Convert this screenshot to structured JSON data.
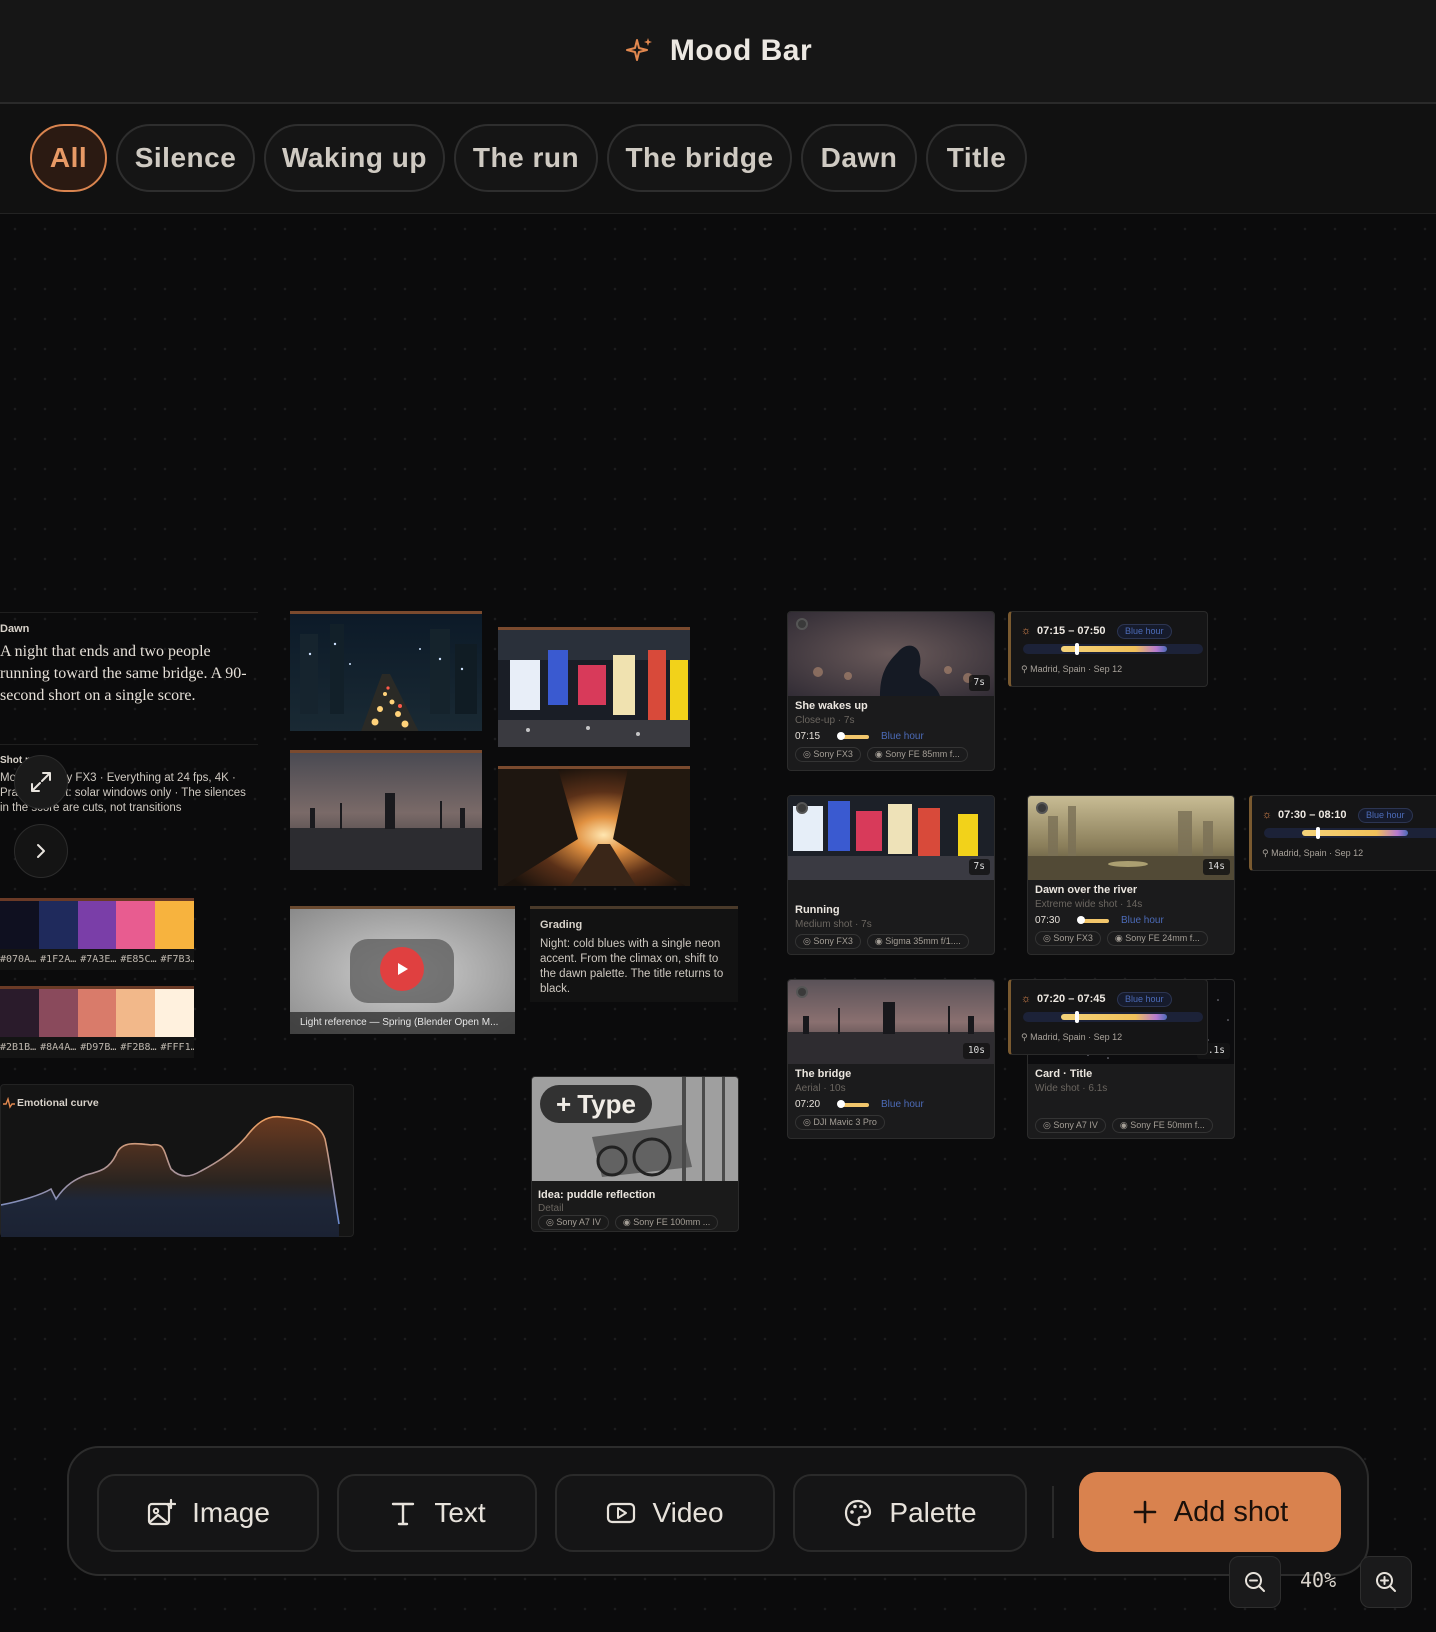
{
  "app": {
    "title": "Mood Bar",
    "icon": "sparkle-icon"
  },
  "tabs": [
    {
      "label": "All",
      "active": true
    },
    {
      "label": "Silence"
    },
    {
      "label": "Waking up"
    },
    {
      "label": "The run"
    },
    {
      "label": "The bridge"
    },
    {
      "label": "Dawn"
    },
    {
      "label": "Title"
    }
  ],
  "dawn_note": {
    "label": "Dawn",
    "text": "A night that ends and two people running toward the same bridge. A 90-second short on a single score."
  },
  "shot_notes": {
    "label": "Shot notes",
    "text": "Mostly a Sony FX3 · Everything at 24 fps, 4K · Practical light: solar windows only · The silences in the score are cuts, not transitions"
  },
  "palettes": [
    {
      "colors": [
        "#0F1020",
        "#1F2A5C",
        "#7A3EA8",
        "#E85C90",
        "#F7B33E"
      ],
      "codes": [
        "#070A…",
        "#1F2A…",
        "#7A3E…",
        "#E85C…",
        "#F7B3…"
      ]
    },
    {
      "colors": [
        "#2A1B2B",
        "#8A4A5C",
        "#D97B6A",
        "#F2B88A",
        "#FFF1DE"
      ],
      "codes": [
        "#2B1B…",
        "#8A4A…",
        "#D97B…",
        "#F2B8…",
        "#FFF1…"
      ]
    }
  ],
  "emotional_curve": {
    "label": "Emotional curve"
  },
  "video_ref": {
    "caption": "Light reference — Spring (Blender Open M..."
  },
  "grading": {
    "label": "Grading",
    "text": "Night: cold blues with a single neon accent. From the climax on, shift to the dawn palette. The title returns to black."
  },
  "idea": {
    "type_label": "Type",
    "name": "Idea: puddle reflection",
    "meta": "Detail",
    "chips": [
      "Sony A7 IV",
      "Sony FE 100mm ..."
    ]
  },
  "shots": [
    {
      "id": "wake",
      "name": "She wakes up",
      "meta": "Close-up · 7s",
      "duration": "7s",
      "time": "07:15",
      "light": "Blue hour",
      "chips": [
        "Sony FX3",
        "Sony FE 85mm f..."
      ]
    },
    {
      "id": "run",
      "name": "Running",
      "meta": "Medium shot · 7s",
      "duration": "7s",
      "time": "",
      "light": "",
      "chips": [
        "Sony FX3",
        "Sigma 35mm f/1...."
      ]
    },
    {
      "id": "river",
      "name": "Dawn over the river",
      "meta": "Extreme wide shot · 14s",
      "duration": "14s",
      "time": "07:30",
      "light": "Blue hour",
      "chips": [
        "Sony FX3",
        "Sony FE 24mm f..."
      ]
    },
    {
      "id": "bridge",
      "name": "The bridge",
      "meta": "Aerial · 10s",
      "duration": "10s",
      "time": "07:20",
      "light": "Blue hour",
      "chips": [
        "DJI Mavic 3 Pro"
      ]
    },
    {
      "id": "title",
      "name": "Card · Title",
      "meta": "Wide shot · 6.1s",
      "duration": "6.1s",
      "time": "",
      "light": "",
      "chips": [
        "Sony A7 IV",
        "Sony FE 50mm f..."
      ]
    }
  ],
  "timecards": [
    {
      "range": "07:15 – 07:50",
      "badge": "Blue hour",
      "location": "Madrid, Spain · Sep 12"
    },
    {
      "range": "07:30 – 08:10",
      "badge": "Blue hour",
      "location": "Madrid, Spain · Sep 12"
    },
    {
      "range": "07:20 – 07:45",
      "badge": "Blue hour",
      "location": "Madrid, Spain · Sep 12"
    }
  ],
  "toolbar": {
    "image": "Image",
    "text": "Text",
    "video": "Video",
    "palette": "Palette",
    "add_shot": "Add shot"
  },
  "zoom": {
    "value": "40%"
  }
}
